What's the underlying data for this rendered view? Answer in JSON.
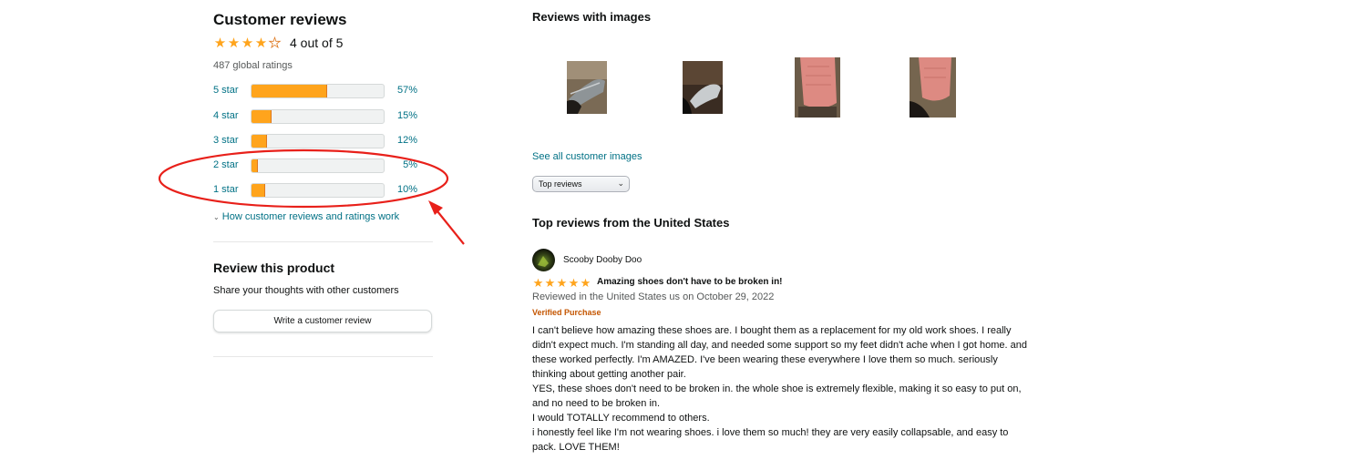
{
  "ratings": {
    "title": "Customer reviews",
    "average_text": "4 out of 5",
    "average_value": 4.5,
    "global_ratings": "487 global ratings",
    "histogram": [
      {
        "label": "5 star",
        "percent": "57%",
        "fraction": 0.57
      },
      {
        "label": "4 star",
        "percent": "15%",
        "fraction": 0.15
      },
      {
        "label": "3 star",
        "percent": "12%",
        "fraction": 0.12
      },
      {
        "label": "2 star",
        "percent": "5%",
        "fraction": 0.05
      },
      {
        "label": "1 star",
        "percent": "10%",
        "fraction": 0.1
      }
    ],
    "how_link": "How customer reviews and ratings work",
    "star_color": "#FFA41C"
  },
  "review_product": {
    "title": "Review this product",
    "subtitle": "Share your thoughts with other customers",
    "button_label": "Write a customer review"
  },
  "images_section": {
    "title": "Reviews with images",
    "see_all": "See all customer images",
    "thumbnails": [
      "review-image-1",
      "review-image-2",
      "review-image-3",
      "review-image-4"
    ]
  },
  "sort": {
    "selected": "Top reviews"
  },
  "top_reviews": {
    "title": "Top reviews from the United States",
    "reviews": [
      {
        "reviewer": "Scooby Dooby Doo",
        "rating": 5,
        "title": "Amazing shoes don't have to be broken in!",
        "date": "Reviewed in the United States us on October 29, 2022",
        "badge": "Verified Purchase",
        "body": [
          "I can't believe how amazing these shoes are. I bought them as a replacement for my old work shoes. I really didn't expect much. I'm standing all day, and needed some support so my feet didn't ache when I got home. and these worked perfectly. I'm AMAZED. I've been wearing these everywhere I love them so much. seriously thinking about getting another pair.",
          "YES, these shoes don't need to be broken in. the whole shoe is extremely flexible, making it so easy to put on, and no need to be broken in.",
          "I would TOTALLY recommend to others.",
          "i honestly feel like I'm not wearing shoes. i love them so much! they are very easily collapsable, and easy to pack. LOVE THEM!"
        ]
      }
    ]
  },
  "annotation": {
    "color": "#E8201A"
  }
}
